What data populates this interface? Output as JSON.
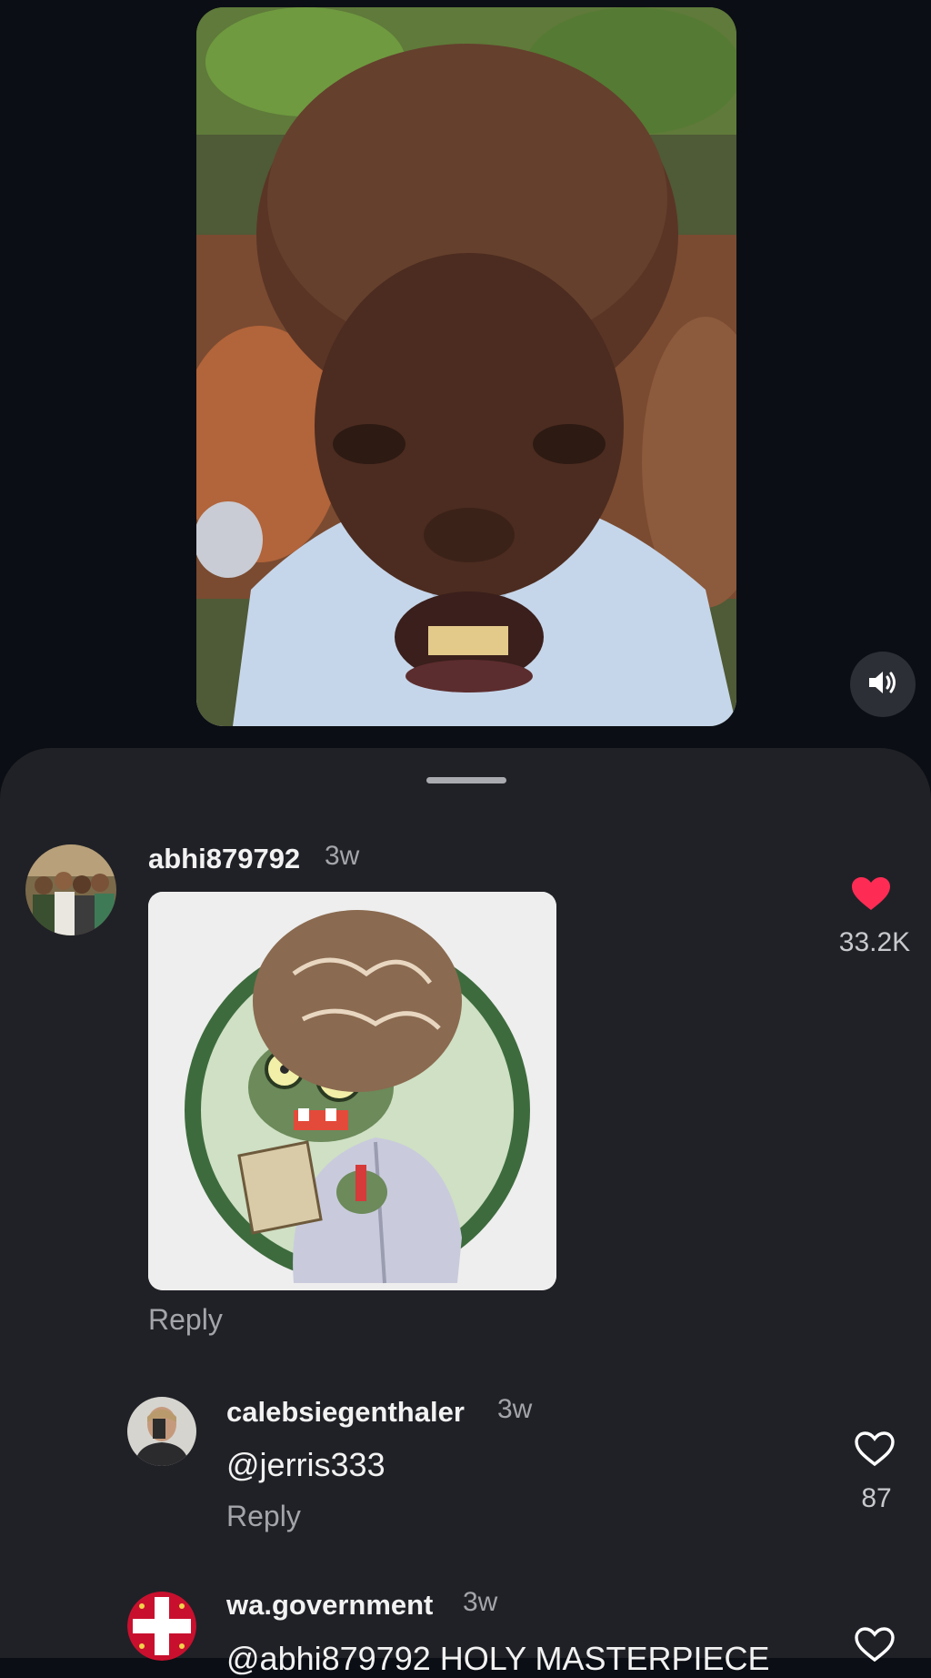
{
  "video": {
    "sound_icon": "speaker-volume-icon"
  },
  "comments": [
    {
      "username": "abhi879792",
      "time": "3w",
      "attachment": "zombie-scientist-sticker",
      "reply_label": "Reply",
      "like_count": "33.2K",
      "liked": true
    },
    {
      "username": "calebsiegenthaler",
      "time": "3w",
      "text": "@jerris333",
      "reply_label": "Reply",
      "like_count": "87",
      "liked": false
    },
    {
      "username": "wa.government",
      "time": "3w",
      "text": "@abhi879792 HOLY MASTERPIECE",
      "liked": false
    }
  ],
  "colors": {
    "background": "#0b0e14",
    "sheet": "#202126",
    "like_red": "#fe2c55",
    "muted_text": "#a3a5aa"
  }
}
